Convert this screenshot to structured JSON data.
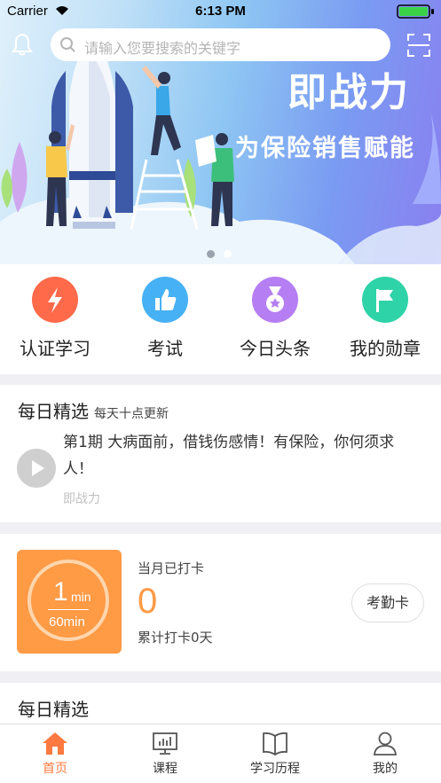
{
  "status_bar": {
    "carrier": "Carrier",
    "time": "6:13 PM"
  },
  "search": {
    "placeholder": "请输入您要搜索的关键字"
  },
  "banner": {
    "title": "即战力",
    "subtitle": "为保险销售赋能",
    "slide_count": 2,
    "active_slide": 1
  },
  "quick_menu": [
    {
      "label": "认证学习",
      "icon": "lightning-icon",
      "color": "#ff6a4b"
    },
    {
      "label": "考试",
      "icon": "thumbs-up-icon",
      "color": "#46b1f5"
    },
    {
      "label": "今日头条",
      "icon": "medal-icon",
      "color": "#b57ef2"
    },
    {
      "label": "我的勋章",
      "icon": "flag-icon",
      "color": "#2fd3a8"
    }
  ],
  "daily_pick": {
    "title": "每日精选",
    "subtitle": "每天十点更新",
    "episode_title": "第1期 大病面前，借钱伤感情！有保险，你何须求人！",
    "episode_source": "即战力"
  },
  "checkin": {
    "minutes": "1",
    "minutes_unit": "min",
    "goal": "60min",
    "month_label": "当月已打卡",
    "month_count": "0",
    "total_label": "累计打卡0天",
    "attendance_button": "考勤卡",
    "accent": "#ff9a45"
  },
  "daily_pick_2": {
    "title": "每日精选"
  },
  "tab_bar": {
    "active_color": "#ff7a40",
    "tabs": [
      {
        "label": "首页",
        "icon": "home-icon",
        "active": true
      },
      {
        "label": "课程",
        "icon": "presentation-board-icon",
        "active": false
      },
      {
        "label": "学习历程",
        "icon": "open-book-icon",
        "active": false
      },
      {
        "label": "我的",
        "icon": "person-icon",
        "active": false
      }
    ]
  }
}
